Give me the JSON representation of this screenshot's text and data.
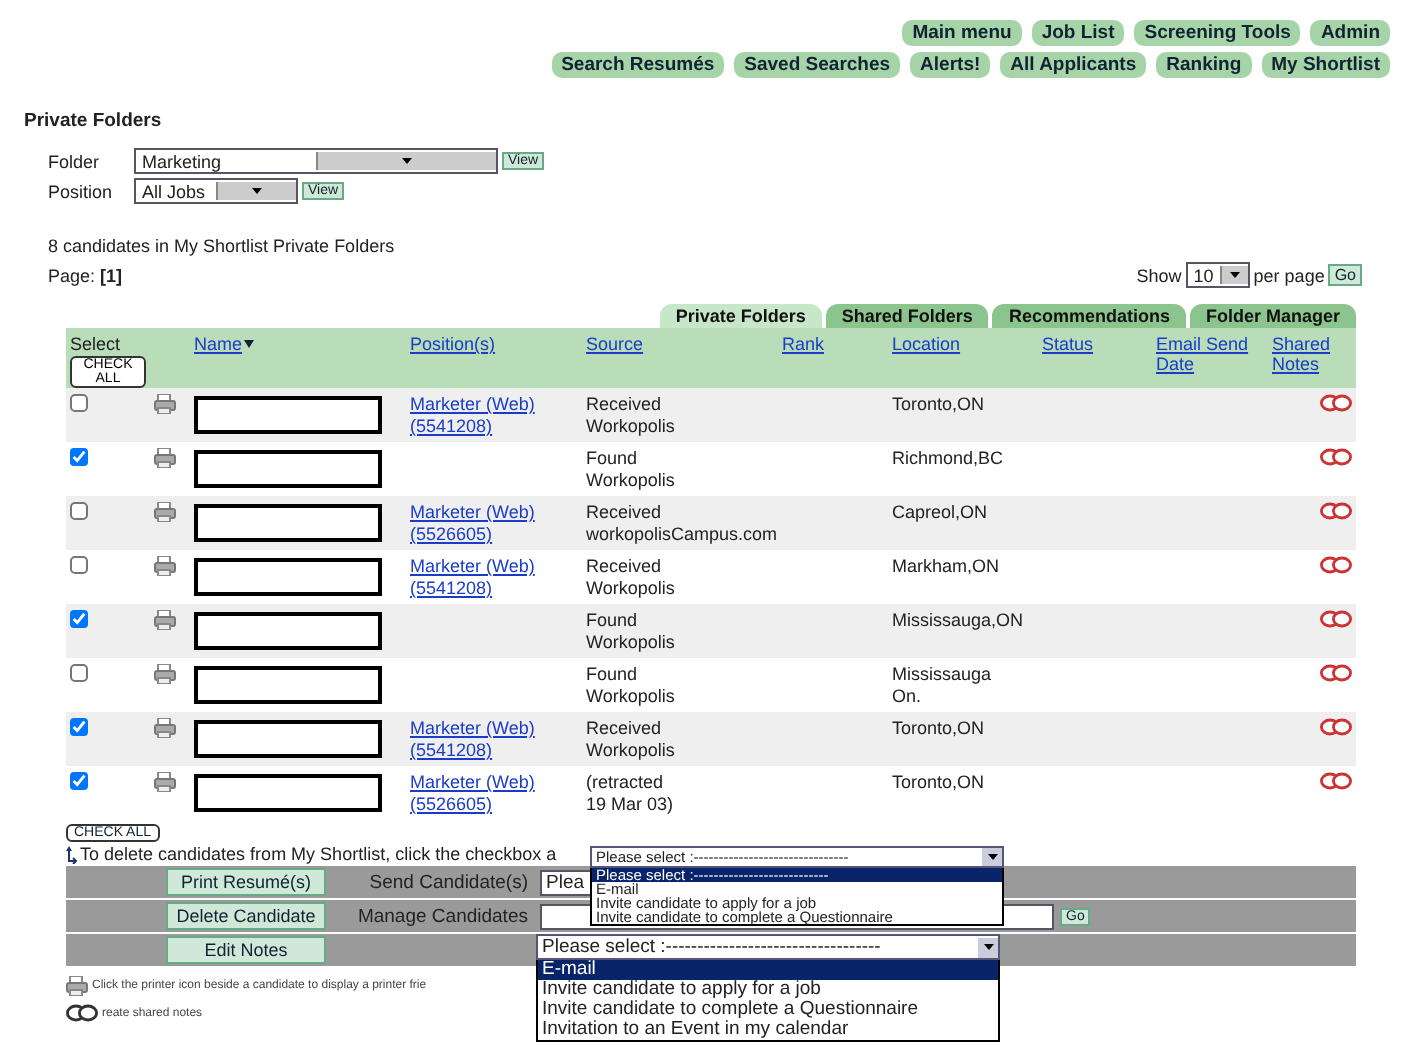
{
  "nav": [
    [
      {
        "label": "Main menu"
      },
      {
        "label": "Job List"
      },
      {
        "label": "Screening Tools"
      },
      {
        "label": "Admin"
      }
    ],
    [
      {
        "label": "Search Resumés"
      },
      {
        "label": "Saved Searches"
      },
      {
        "label": "Alerts!"
      },
      {
        "label": "All Applicants"
      },
      {
        "label": "Ranking"
      },
      {
        "label": "My Shortlist"
      }
    ]
  ],
  "title": "Private Folders",
  "filters": [
    {
      "label": "Folder",
      "value": "Marketing",
      "button": "View",
      "wide": true
    },
    {
      "label": "Position",
      "value": "All Jobs",
      "button": "View",
      "wide": false
    }
  ],
  "summary": "8 candidates in My Shortlist Private Folders",
  "page": {
    "label": "Page:",
    "current": "[1]"
  },
  "paging": {
    "before": "Show",
    "value": "10",
    "after": "per page",
    "button": "Go"
  },
  "tabs": [
    {
      "label": "Private Folders",
      "selected": true
    },
    {
      "label": "Shared Folders",
      "selected": false
    },
    {
      "label": "Recommendations",
      "selected": false
    },
    {
      "label": "Folder Manager",
      "selected": false
    }
  ],
  "check_all": "CHECK ALL",
  "columns": [
    {
      "label": "Select",
      "kind": "plain"
    },
    {
      "label": "Name",
      "kind": "sorted"
    },
    {
      "label": "Position(s)",
      "kind": "link"
    },
    {
      "label": "Source",
      "kind": "link"
    },
    {
      "label": "Rank",
      "kind": "link"
    },
    {
      "label": "Location",
      "kind": "link"
    },
    {
      "label": "Status",
      "kind": "link"
    },
    {
      "label": "Email Send Date",
      "kind": "link"
    },
    {
      "label": "Shared Notes",
      "kind": "link"
    }
  ],
  "rows": [
    {
      "checked": false,
      "position": [
        "Marketer (Web)",
        "(5541208)"
      ],
      "source": [
        "Received",
        "Workopolis"
      ],
      "location": [
        "Toronto,ON"
      ]
    },
    {
      "checked": true,
      "position": [],
      "source": [
        "Found",
        "Workopolis"
      ],
      "location": [
        "Richmond,BC"
      ]
    },
    {
      "checked": false,
      "position": [
        "Marketer (Web)",
        "(5526605)"
      ],
      "source": [
        "Received",
        "workopolisCampus.com"
      ],
      "location": [
        "Capreol,ON"
      ]
    },
    {
      "checked": false,
      "position": [
        "Marketer (Web)",
        "(5541208)"
      ],
      "source": [
        "Received",
        "Workopolis"
      ],
      "location": [
        "Markham,ON"
      ]
    },
    {
      "checked": true,
      "position": [],
      "source": [
        "Found",
        "Workopolis"
      ],
      "location": [
        "Mississauga,ON"
      ]
    },
    {
      "checked": false,
      "position": [],
      "source": [
        "Found",
        "Workopolis"
      ],
      "location": [
        "Mississauga",
        "On."
      ]
    },
    {
      "checked": true,
      "position": [
        "Marketer (Web)",
        "(5541208)"
      ],
      "source": [
        "Received",
        "Workopolis"
      ],
      "location": [
        "Toronto,ON"
      ]
    },
    {
      "checked": true,
      "position": [
        "Marketer (Web)",
        "(5526605)"
      ],
      "source": [
        "(retracted",
        "19 Mar 03)"
      ],
      "location": [
        "Toronto,ON"
      ]
    }
  ],
  "bottom": {
    "check_all": "CHECK ALL",
    "note": "To delete candidates from My Shortlist, click the checkbox a",
    "actions": [
      {
        "button": "Print Resumé(s)",
        "label": "Send Candidate(s)",
        "select": "Plea"
      },
      {
        "button": "Delete Candidate",
        "label": "Manage Candidates",
        "go": "Go"
      },
      {
        "button": "Edit Notes"
      }
    ]
  },
  "dropdowns": [
    {
      "value": "Please select :-------------------------------",
      "options": [
        {
          "label": "Please select :---------------------------",
          "selected": true
        },
        {
          "label": "E-mail",
          "selected": false
        },
        {
          "label": "Invite candidate to apply for a job",
          "selected": false
        },
        {
          "label": "Invite candidate to complete a Questionnaire",
          "selected": false
        }
      ]
    },
    {
      "value": "Please select :----------------------------------",
      "options": [
        {
          "label": "E-mail",
          "selected": true
        },
        {
          "label": "Invite candidate to apply for a job",
          "selected": false
        },
        {
          "label": "Invite candidate to complete a Questionnaire",
          "selected": false
        },
        {
          "label": "Invitation to an Event in my calendar",
          "selected": false
        }
      ]
    }
  ],
  "footnotes": [
    {
      "kind": "printer",
      "text": "Click the printer icon beside a candidate to display a printer frie"
    },
    {
      "kind": "notes",
      "text": "reate shared notes"
    }
  ]
}
